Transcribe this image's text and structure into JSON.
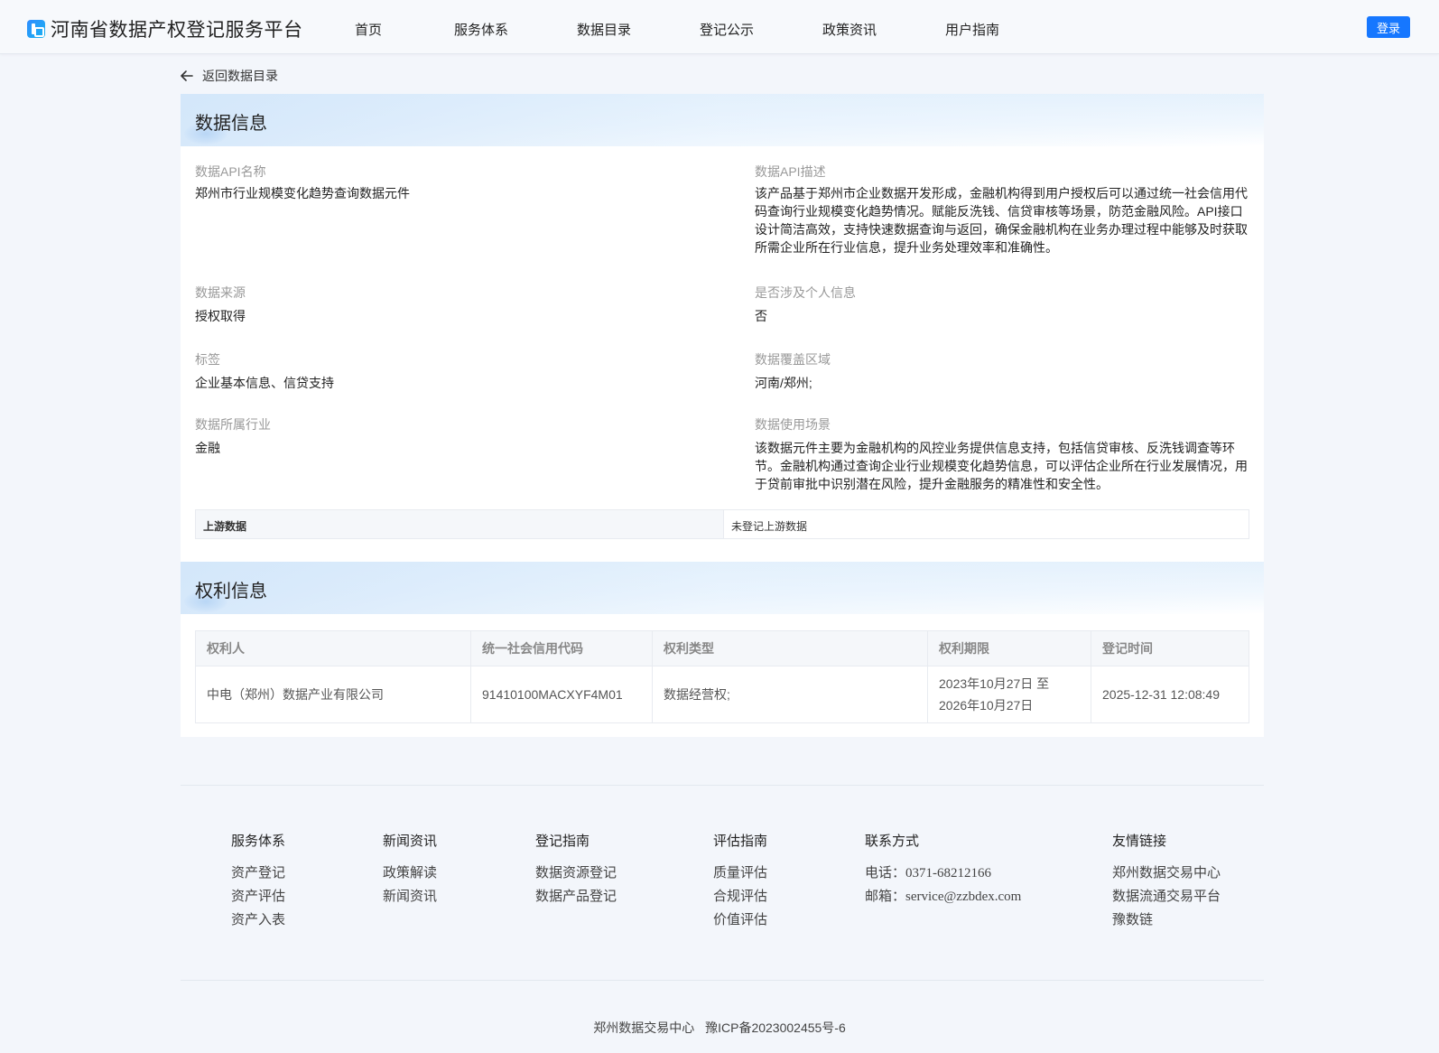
{
  "header": {
    "site_title": "河南省数据产权登记服务平台",
    "nav": [
      "首页",
      "服务体系",
      "数据目录",
      "登记公示",
      "政策资讯",
      "用户指南"
    ],
    "login_label": "登录",
    "colors": {
      "accent": "#1677ff"
    }
  },
  "back_link": "返回数据目录",
  "data_info": {
    "title": "数据信息",
    "fields": [
      {
        "label": "数据API名称",
        "value": "郑州市行业规模变化趋势查询数据元件"
      },
      {
        "label": "数据API描述",
        "value": "该产品基于郑州市企业数据开发形成，金融机构得到用户授权后可以通过统一社会信用代码查询行业规模变化趋势情况。赋能反洗钱、信贷审核等场景，防范金融风险。API接口设计简洁高效，支持快速数据查询与返回，确保金融机构在业务办理过程中能够及时获取所需企业所在行业信息，提升业务处理效率和准确性。"
      },
      {
        "label": "数据来源",
        "value": "授权取得"
      },
      {
        "label": "是否涉及个人信息",
        "value": "否"
      },
      {
        "label": "标签",
        "value": "企业基本信息、信贷支持"
      },
      {
        "label": "数据覆盖区域",
        "value": "河南/郑州;"
      },
      {
        "label": "数据所属行业",
        "value": "金融"
      },
      {
        "label": "数据使用场景",
        "value": "该数据元件主要为金融机构的风控业务提供信息支持，包括信贷审核、反洗钱调查等环节。金融机构通过查询企业行业规模变化趋势信息，可以评估企业所在行业发展情况，用于贷前审批中识别潜在风险，提升金融服务的精准性和安全性。"
      }
    ],
    "upstream": {
      "label": "上游数据",
      "value": "未登记上游数据"
    }
  },
  "rights_info": {
    "title": "权利信息",
    "columns": [
      "权利人",
      "统一社会信用代码",
      "权利类型",
      "权利期限",
      "登记时间"
    ],
    "rows": [
      {
        "holder": "中电（郑州）数据产业有限公司",
        "credit_code": "91410100MACXYF4M01",
        "right_type": "数据经营权;",
        "term_line1": "2023年10月27日 至",
        "term_line2": "2026年10月27日",
        "registered_at": "2025-12-31 12:08:49"
      }
    ]
  },
  "footer": {
    "columns": [
      {
        "title": "服务体系",
        "links": [
          "资产登记",
          "资产评估",
          "资产入表"
        ]
      },
      {
        "title": "新闻资讯",
        "links": [
          "政策解读",
          "新闻资讯"
        ]
      },
      {
        "title": "登记指南",
        "links": [
          "数据资源登记",
          "数据产品登记"
        ]
      },
      {
        "title": "评估指南",
        "links": [
          "质量评估",
          "合规评估",
          "价值评估"
        ]
      },
      {
        "title": "联系方式",
        "links": [
          "电话：0371-68212166",
          "邮箱：service@zzbdex.com"
        ]
      },
      {
        "title": "友情链接",
        "links": [
          "郑州数据交易中心",
          "数据流通交易平台",
          "豫数链"
        ]
      }
    ],
    "org": "郑州数据交易中心",
    "icp": "豫ICP备2023002455号-6"
  }
}
